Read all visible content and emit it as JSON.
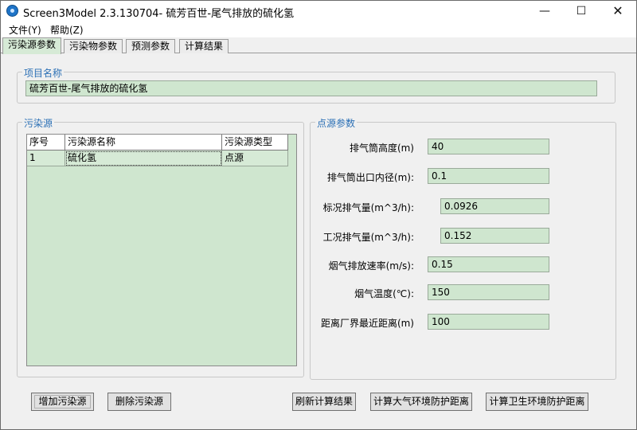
{
  "window": {
    "title": "Screen3Model 2.3.130704- 硫芳百世-尾气排放的硫化氢",
    "minimize_glyph": "—",
    "maximize_glyph": "☐",
    "close_glyph": "✕"
  },
  "menu": [
    "文件(Y)",
    "帮助(Z)"
  ],
  "tabs": [
    "污染源参数",
    "污染物参数",
    "预测参数",
    "计算结果"
  ],
  "project": {
    "group_title": "项目名称",
    "name": "硫芳百世-尾气排放的硫化氢"
  },
  "sources": {
    "group_title": "污染源",
    "columns": [
      "序号",
      "污染源名称",
      "污染源类型"
    ],
    "rows": [
      [
        "1",
        "硫化氢",
        "点源"
      ]
    ]
  },
  "point_source": {
    "group_title": "点源参数",
    "fields": [
      {
        "label": "排气筒高度(m)",
        "value": "40"
      },
      {
        "label": "排气筒出口内径(m):",
        "value": "0.1"
      },
      {
        "label": "标况排气量(m^3/h):",
        "value": "0.0926"
      },
      {
        "label": "工况排气量(m^3/h):",
        "value": "0.152"
      },
      {
        "label": "烟气排放速率(m/s):",
        "value": "0.15"
      },
      {
        "label": "烟气温度(℃):",
        "value": "150"
      },
      {
        "label": "距离厂界最近距离(m)",
        "value": "100"
      }
    ]
  },
  "buttons": {
    "add_source": "增加污染源",
    "delete_source": "删除污染源",
    "refresh_results": "刷新计算结果",
    "calc_atmos_distance": "计算大气环境防护距离",
    "calc_health_distance": "计算卫生环境防护距离"
  },
  "colors": {
    "field_bg": "#cfe6cf",
    "group_title": "#2a6fb5",
    "active_tab": "#d6ead6"
  }
}
